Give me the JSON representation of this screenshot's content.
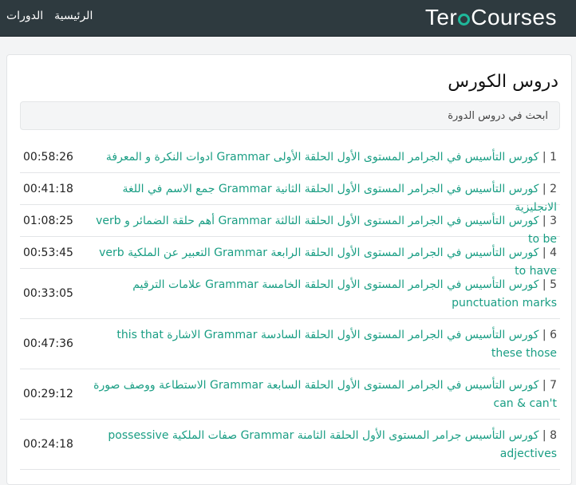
{
  "nav": {
    "logo": {
      "prefix": "Ter",
      "suffix": "Courses"
    },
    "links": [
      "الرئيسية",
      "الدورات"
    ]
  },
  "page": {
    "title": "دروس الكورس"
  },
  "search": {
    "placeholder": "ابحث في دروس الدورة"
  },
  "lessons": [
    {
      "num": "1 |",
      "title": "كورس التأسيس في الجرامر المستوى الأول الحلقة الأولى Grammar ادوات النكرة و المعرفة",
      "duration": "00:58:26"
    },
    {
      "num": "2 |",
      "title": "كورس التأسيس في الجرامر المستوى الأول الحلقة الثانية Grammar جمع الاسم في اللغة الانجليزية",
      "duration": "00:41:18"
    },
    {
      "num": "3 |",
      "title": "كورس التأسيس في الجرامر المستوى الأول الحلقة الثالثة Grammar أهم حلقة الضمائر و verb to be",
      "duration": "01:08:25"
    },
    {
      "num": "4 |",
      "title": "كورس التأسيس في الجرامر المستوى الأول الحلقة الرابعة Grammar التعبير عن الملكية verb to have",
      "duration": "00:53:45"
    },
    {
      "num": "5 |",
      "title": "كورس التأسيس في الجرامر المستوى الأول الحلقة الخامسة Grammar علامات الترقيم punctuation marks",
      "duration": "00:33:05"
    },
    {
      "num": "6 |",
      "title": "كورس التأسيس في الجرامر المستوى الأول الحلقة السادسة Grammar الاشارة this that these those",
      "duration": "00:47:36"
    },
    {
      "num": "7 |",
      "title": "كورس التأسيس في الجرامر المستوى الأول الحلقة السابعة Grammar الاستطاعة ووصف صورة can & can't",
      "duration": "00:29:12"
    },
    {
      "num": "8 |",
      "title": "كورس التأسيس جرامر المستوى الأول الحلقة الثامنة Grammar صفات الملكية possessive adjectives",
      "duration": "00:24:18"
    }
  ]
}
